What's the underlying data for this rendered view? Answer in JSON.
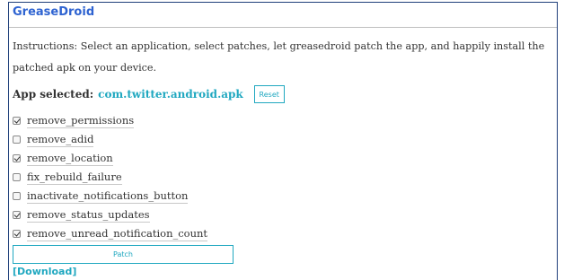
{
  "app_title": "GreaseDroid",
  "instructions": "Instructions: Select an application, select patches, let greasedroid patch the app, and happily install the patched apk on your device.",
  "app_selection": {
    "label": "App selected:",
    "value": "com.twitter.android.apk",
    "reset_label": "Reset"
  },
  "patches": [
    {
      "label": "remove_permissions",
      "checked": true
    },
    {
      "label": "remove_adid",
      "checked": false
    },
    {
      "label": "remove_location",
      "checked": true
    },
    {
      "label": "fix_rebuild_failure",
      "checked": false
    },
    {
      "label": "inactivate_notifications_button",
      "checked": false
    },
    {
      "label": "remove_status_updates",
      "checked": true
    },
    {
      "label": "remove_unread_notification_count",
      "checked": true
    }
  ],
  "patch_button_label": "Patch",
  "download_link_label": "[Download]",
  "colors": {
    "title": "#2e63d1",
    "accent": "#20a8c0",
    "frame": "#1f3f7a"
  }
}
